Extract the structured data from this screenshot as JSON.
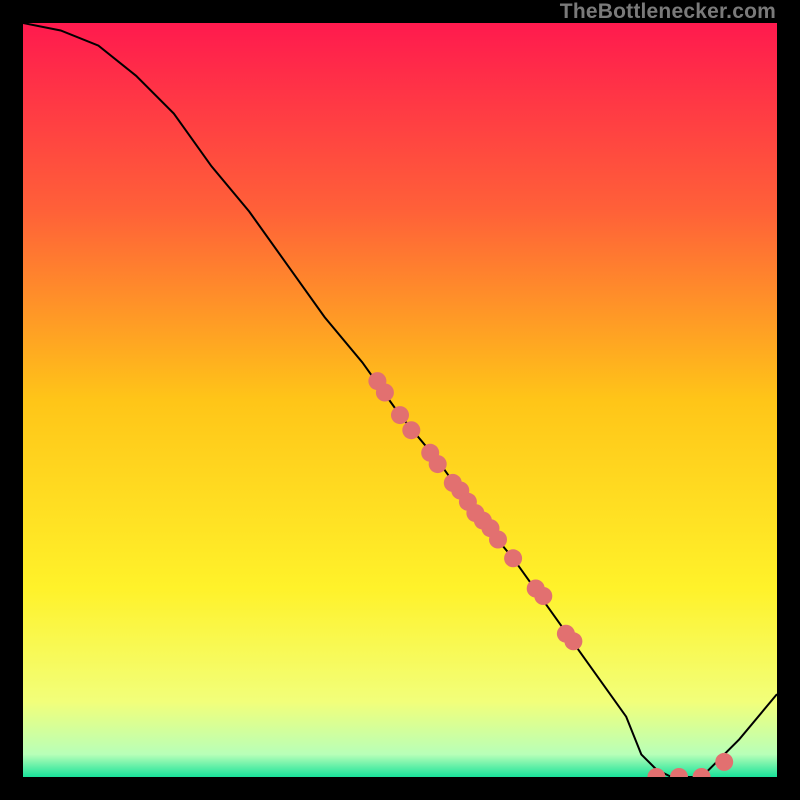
{
  "watermark": "TheBottlenecker.com",
  "chart_data": {
    "type": "line",
    "title": "",
    "xlabel": "",
    "ylabel": "",
    "xlim": [
      0,
      100
    ],
    "ylim": [
      0,
      100
    ],
    "grid": false,
    "legend": false,
    "series": [
      {
        "name": "curve",
        "x": [
          0,
          5,
          10,
          15,
          20,
          25,
          30,
          35,
          40,
          45,
          50,
          55,
          60,
          65,
          70,
          75,
          80,
          82,
          84,
          86,
          90,
          95,
          100
        ],
        "y": [
          100,
          99,
          97,
          93,
          88,
          81,
          75,
          68,
          61,
          55,
          48,
          42,
          35,
          29,
          22,
          15,
          8,
          3,
          1,
          0,
          0,
          5,
          11
        ],
        "color": "#000000",
        "linewidth": 2
      }
    ],
    "markers": [
      {
        "x": 47,
        "y": 52.5
      },
      {
        "x": 48,
        "y": 51
      },
      {
        "x": 50,
        "y": 48
      },
      {
        "x": 51.5,
        "y": 46
      },
      {
        "x": 54,
        "y": 43
      },
      {
        "x": 55,
        "y": 41.5
      },
      {
        "x": 57,
        "y": 39
      },
      {
        "x": 58,
        "y": 38
      },
      {
        "x": 59,
        "y": 36.5
      },
      {
        "x": 60,
        "y": 35
      },
      {
        "x": 61,
        "y": 34
      },
      {
        "x": 62,
        "y": 33
      },
      {
        "x": 63,
        "y": 31.5
      },
      {
        "x": 65,
        "y": 29
      },
      {
        "x": 68,
        "y": 25
      },
      {
        "x": 69,
        "y": 24
      },
      {
        "x": 72,
        "y": 19
      },
      {
        "x": 73,
        "y": 18
      },
      {
        "x": 84,
        "y": 0
      },
      {
        "x": 87,
        "y": 0
      },
      {
        "x": 90,
        "y": 0
      },
      {
        "x": 93,
        "y": 2
      }
    ],
    "marker_style": {
      "color": "#e27070",
      "radius": 9
    },
    "background_gradient": {
      "stops": [
        {
          "y": 100,
          "color": "#ff1a4e"
        },
        {
          "y": 75,
          "color": "#ff6138"
        },
        {
          "y": 50,
          "color": "#ffc518"
        },
        {
          "y": 25,
          "color": "#fff22a"
        },
        {
          "y": 10,
          "color": "#f2ff7a"
        },
        {
          "y": 3,
          "color": "#b8ffb8"
        },
        {
          "y": 0,
          "color": "#18e29a"
        }
      ]
    }
  }
}
